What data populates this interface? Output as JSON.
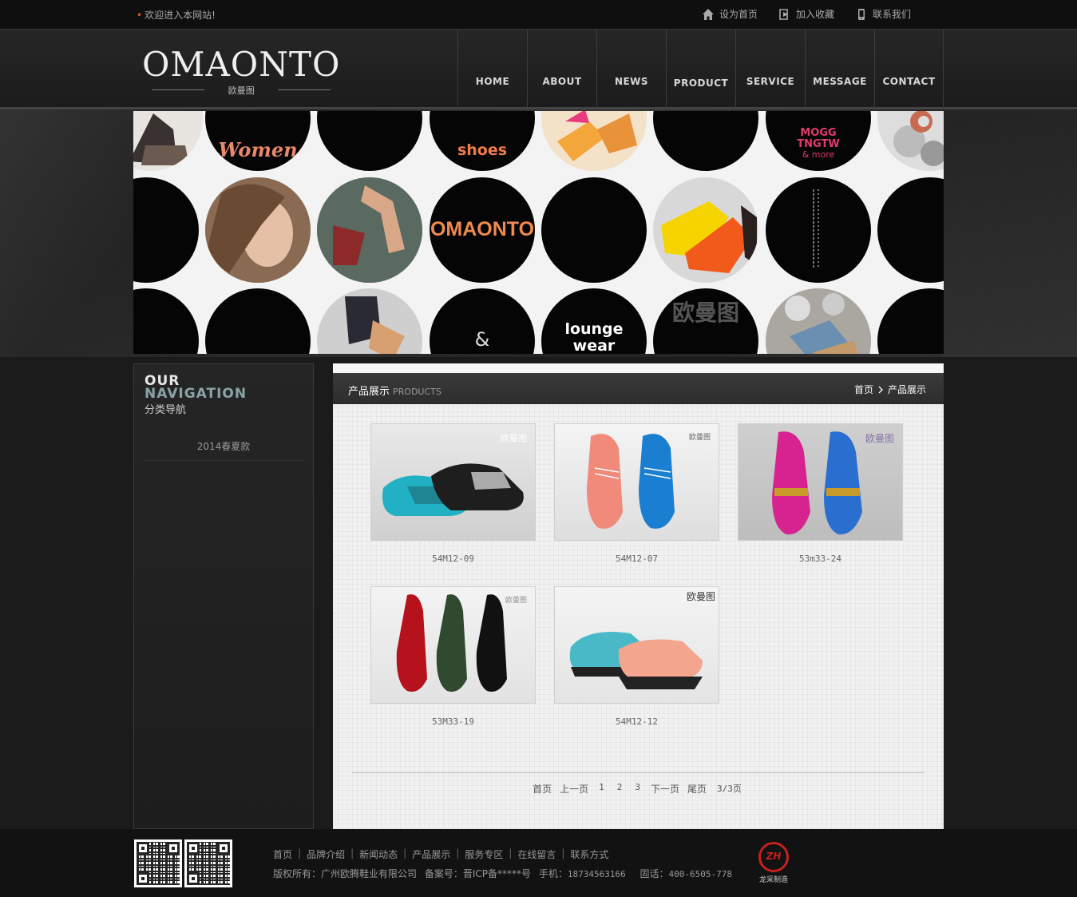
{
  "topbar": {
    "welcome": "欢迎进入本网站!",
    "links": [
      {
        "label": "设为首页",
        "icon": "home-icon"
      },
      {
        "label": "加入收藏",
        "icon": "bookmark-icon"
      },
      {
        "label": "联系我们",
        "icon": "phone-icon"
      }
    ]
  },
  "header": {
    "logo_text": "OMAONTO",
    "logo_sub": "欧曼图",
    "nav": [
      "HOME",
      "ABOUT",
      "NEWS",
      "PRODUCT",
      "SERVICE",
      "MESSAGE",
      "CONTACT"
    ],
    "active_nav": "PRODUCT"
  },
  "banner": {
    "texts": {
      "women": "Women",
      "shoes": "shoes",
      "mogg": "MOGG",
      "tngtw": "TNGTW",
      "more": "& more",
      "brand": "OMAONTO",
      "ampersand": "&",
      "lounge": "lounge wear",
      "cn_brand": "欧曼图"
    }
  },
  "sidebar": {
    "title_our": "OUR",
    "title_nav": "NAVIGATION",
    "title_cn": "分类导航",
    "items": [
      "2014春夏款"
    ]
  },
  "main": {
    "title": "产品展示",
    "title_en": "PRODUCTS",
    "breadcrumb": [
      "首页",
      "产品展示"
    ],
    "products": [
      {
        "code": "54M12-09",
        "watermark": "欧曼图",
        "colors": [
          "#2bb5c4",
          "#222222"
        ]
      },
      {
        "code": "54M12-07",
        "watermark": "欧曼图",
        "colors": [
          "#f08a7a",
          "#1a7fd0"
        ]
      },
      {
        "code": "53m33-24",
        "watermark": "欧曼图",
        "colors": [
          "#d6238f",
          "#2a6fd0"
        ]
      },
      {
        "code": "53M33-19",
        "watermark": "欧曼图",
        "colors": [
          "#b5121b",
          "#2f4a2f"
        ]
      },
      {
        "code": "54M12-12",
        "watermark": "欧曼图",
        "colors": [
          "#49b9c8",
          "#f3a58e"
        ]
      }
    ],
    "pager": {
      "first": "首页",
      "prev": "上一页",
      "pages": [
        "1",
        "2",
        "3"
      ],
      "next": "下一页",
      "last": "尾页",
      "status": "3/3页"
    }
  },
  "footer": {
    "links": [
      "首页",
      "品牌介绍",
      "新闻动态",
      "产品展示",
      "服务专区",
      "在线留言",
      "联系方式"
    ],
    "copyright": "版权所有：广州欧腾鞋业有限公司",
    "icp": "备案号：晋ICP备*****号",
    "phone_label": "手机：",
    "phone": "18734563166",
    "tel_label": "固话：",
    "tel": "400-6505-778",
    "maker": "龙采制造",
    "maker_mark": "ZH"
  }
}
